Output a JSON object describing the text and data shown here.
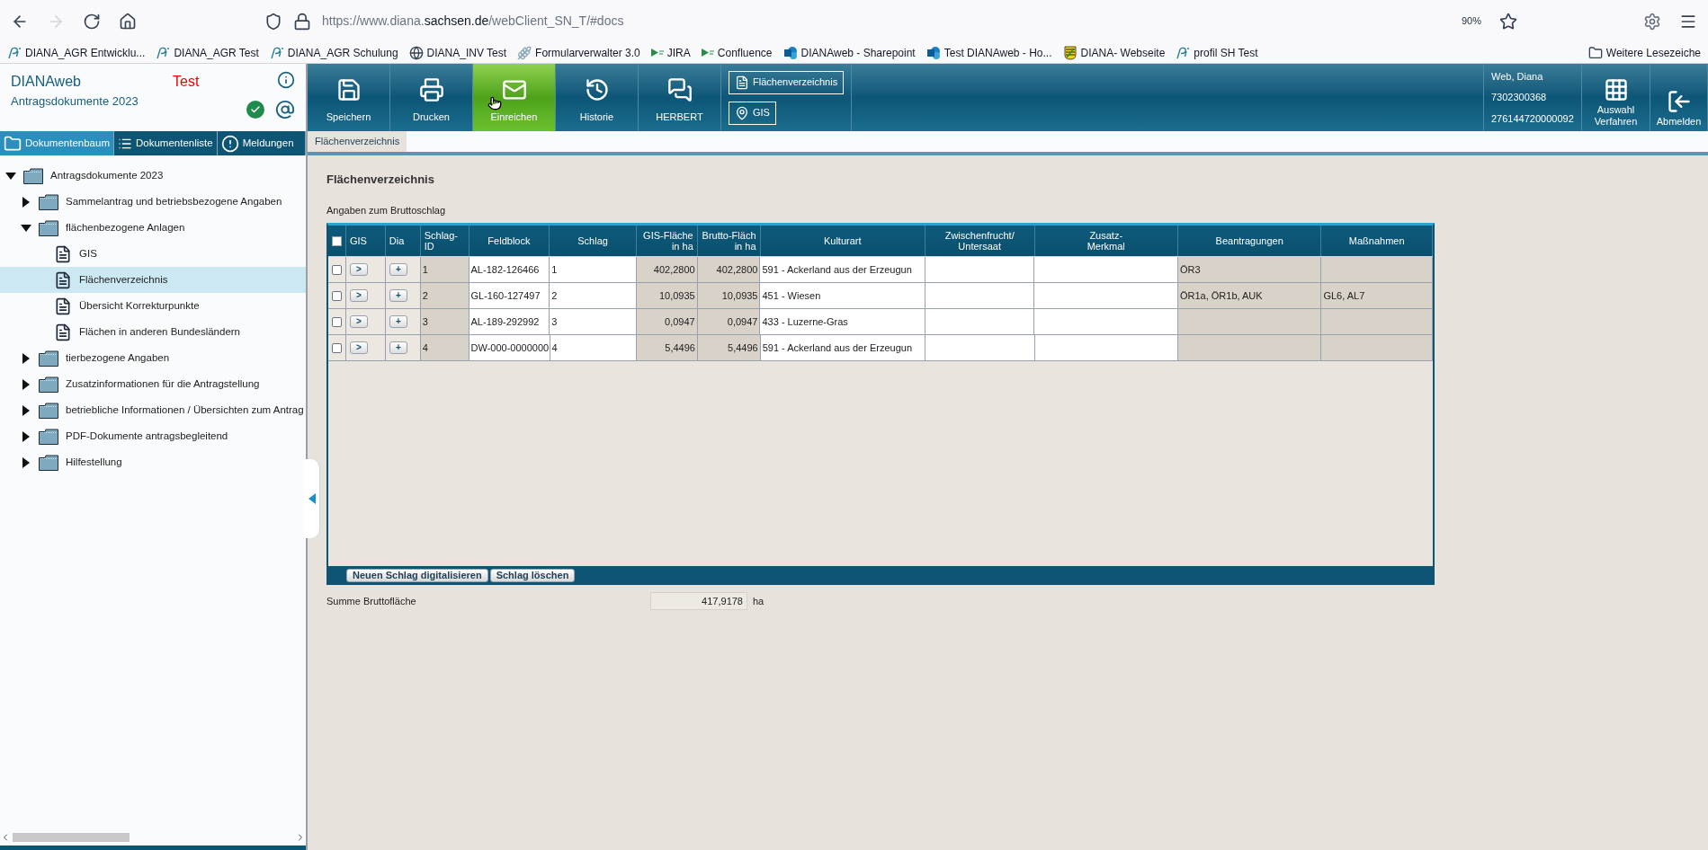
{
  "browser": {
    "forward_disabled": true,
    "url": {
      "prefix": "https://www.diana.",
      "domain": "sachsen.de",
      "path": "/webClient_SN_T/#docs"
    },
    "zoom": "90%",
    "bookmarks": [
      {
        "label": "DIANA_AGR Entwicklu..."
      },
      {
        "label": "DIANA_AGR Test"
      },
      {
        "label": "DIANA_AGR Schulung"
      },
      {
        "label": "DIANA_INV Test"
      },
      {
        "label": "Formularverwalter 3.0"
      },
      {
        "label": "JIRA"
      },
      {
        "label": "Confluence"
      },
      {
        "label": "DIANAweb - Sharepoint"
      },
      {
        "label": "Test DIANAweb - Ho..."
      },
      {
        "label": "DIANA- Webseite"
      },
      {
        "label": "profil SH Test"
      }
    ],
    "other_bookmarks": "Weitere Lesezeiche"
  },
  "app": {
    "name": "DIANAweb",
    "environment": "Test",
    "subtitle": "Antragsdokumente 2023",
    "status_ok": true
  },
  "sidebar_tabs": [
    {
      "label": "Dokumentenbaum",
      "selected": true
    },
    {
      "label": "Dokumentenliste",
      "selected": false
    },
    {
      "label": "Meldungen",
      "selected": false
    }
  ],
  "tree": [
    {
      "label": "Antragsdokumente 2023",
      "kind": "folder",
      "expanded": true,
      "selected": false,
      "children": [
        {
          "label": "Sammelantrag und betriebsbezogene Angaben",
          "kind": "folder",
          "expanded": false,
          "selected": false
        },
        {
          "label": "flächenbezogene Anlagen",
          "kind": "folder",
          "expanded": true,
          "selected": false,
          "children": [
            {
              "label": "GIS",
              "kind": "document",
              "selected": false
            },
            {
              "label": "Flächenverzeichnis",
              "kind": "document",
              "selected": true
            },
            {
              "label": "Übersicht Korrekturpunkte",
              "kind": "document",
              "selected": false
            },
            {
              "label": "Flächen in anderen Bundesländern",
              "kind": "document",
              "selected": false
            }
          ]
        },
        {
          "label": "tierbezogene Angaben",
          "kind": "folder",
          "expanded": false,
          "selected": false
        },
        {
          "label": "Zusatzinformationen für die Antragstellung",
          "kind": "folder",
          "expanded": false,
          "selected": false
        },
        {
          "label": "betriebliche Informationen / Übersichten zum Antrag",
          "kind": "folder",
          "expanded": false,
          "selected": false
        },
        {
          "label": "PDF-Dokumente antragsbegleitend",
          "kind": "folder",
          "expanded": false,
          "selected": false
        },
        {
          "label": "Hilfestellung",
          "kind": "folder",
          "expanded": false,
          "selected": false
        }
      ]
    }
  ],
  "toolbar": [
    {
      "label": "Speichern",
      "selected": false
    },
    {
      "label": "Drucken",
      "selected": false
    },
    {
      "label": "Einreichen",
      "selected": true
    },
    {
      "label": "Historie",
      "selected": false
    },
    {
      "label": "HERBERT",
      "selected": false
    }
  ],
  "context_buttons": [
    {
      "label": "Flächenverzeichnis"
    },
    {
      "label": "GIS"
    }
  ],
  "user": {
    "name": "Web, Diana",
    "number": "7302300368",
    "id": "276144720000092"
  },
  "right_buttons": [
    {
      "label": "Auswahl Verfahren"
    },
    {
      "label": "Abmelden"
    }
  ],
  "tabs": [
    {
      "label": "Flächenverzeichnis",
      "selected": true
    }
  ],
  "page": {
    "title": "Flächenverzeichnis",
    "section": "Angaben zum Bruttoschlag",
    "table": {
      "all_checked": false,
      "columns": [
        {
          "lines": [
            "GIS"
          ]
        },
        {
          "lines": [
            "Dia"
          ]
        },
        {
          "lines": [
            "Schlag-",
            "ID"
          ],
          "editable": false
        },
        {
          "lines": [
            "Feldblock"
          ],
          "editable": true
        },
        {
          "lines": [
            "Schlag"
          ],
          "editable": true
        },
        {
          "lines": [
            "GIS-Fläche",
            "in ha"
          ],
          "editable": false
        },
        {
          "lines": [
            "Brutto-Fläch",
            "in ha"
          ],
          "editable": false
        },
        {
          "lines": [
            "Kulturart"
          ],
          "editable": true
        },
        {
          "lines": [
            "Zwischenfrucht/",
            "Untersaat"
          ],
          "editable": true
        },
        {
          "lines": [
            "Zusatz-",
            "Merkmal"
          ],
          "editable": true
        },
        {
          "lines": [
            "Beantragungen"
          ],
          "editable": false
        },
        {
          "lines": [
            "Maßnahmen"
          ],
          "editable": false
        }
      ],
      "rows": [
        {
          "checked": false,
          "cells": [
            ">",
            "+",
            "1",
            "AL-182-126466",
            "1",
            "402,2800",
            "402,2800",
            "591 - Ackerland aus der Erzeugun",
            null,
            null,
            "ÖR3",
            null
          ]
        },
        {
          "checked": false,
          "cells": [
            ">",
            "+",
            "2",
            "GL-160-127497",
            "2",
            "10,0935",
            "10,0935",
            "451 - Wiesen",
            null,
            null,
            "ÖR1a, ÖR1b, AUK",
            "GL6, AL7"
          ]
        },
        {
          "checked": false,
          "cells": [
            ">",
            "+",
            "3",
            "AL-189-292992",
            "3",
            "0,0947",
            "0,0947",
            "433 - Luzerne-Gras",
            null,
            null,
            null,
            null
          ]
        },
        {
          "checked": false,
          "cells": [
            ">",
            "+",
            "4",
            "DW-000-0000000",
            "4",
            "5,4496",
            "5,4496",
            "591 - Ackerland aus der Erzeugun",
            null,
            null,
            null,
            null
          ]
        }
      ]
    },
    "footer_buttons": [
      "Neuen Schlag digitalisieren",
      "Schlag löschen"
    ],
    "sum": {
      "label": "Summe Bruttofläche",
      "value": "417,9178",
      "unit": "ha"
    }
  }
}
